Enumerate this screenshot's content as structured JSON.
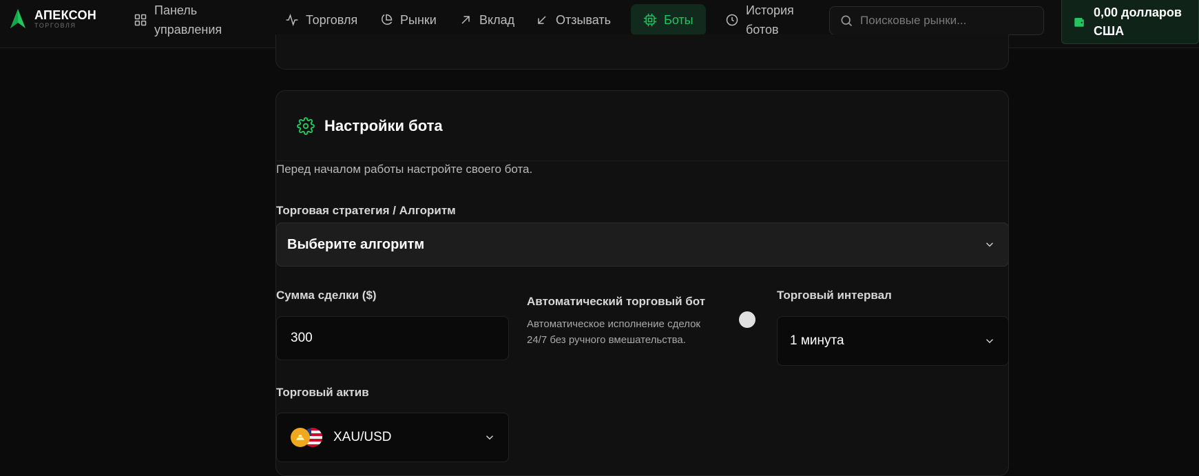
{
  "brand": {
    "name": "АПЕКСОН",
    "subtitle": "ТОРГОВЛЯ",
    "accent": "#22c55e"
  },
  "nav": {
    "dashboard": "Панель управления",
    "trading": "Торговля",
    "markets": "Рынки",
    "deposit": "Вклад",
    "withdraw": "Отзывать",
    "bots": "Боты",
    "bot_history": "История ботов"
  },
  "search": {
    "placeholder": "Поисковые рынки..."
  },
  "wallet": {
    "balance": "0,00 долларов США"
  },
  "bot_settings": {
    "title": "Настройки бота",
    "description": "Перед началом работы настройте своего бота.",
    "strategy_label": "Торговая стратегия / Алгоритм",
    "strategy_value": "Выберите алгоритм",
    "amount_label": "Сумма сделки ($)",
    "amount_value": "300",
    "auto_title": "Автоматический торговый бот",
    "auto_desc": "Автоматическое исполнение сделок 24/7 без ручного вмешательства.",
    "interval_label": "Торговый интервал",
    "interval_value": "1 минута",
    "asset_label": "Торговый актив",
    "asset_value": "XAU/USD"
  }
}
